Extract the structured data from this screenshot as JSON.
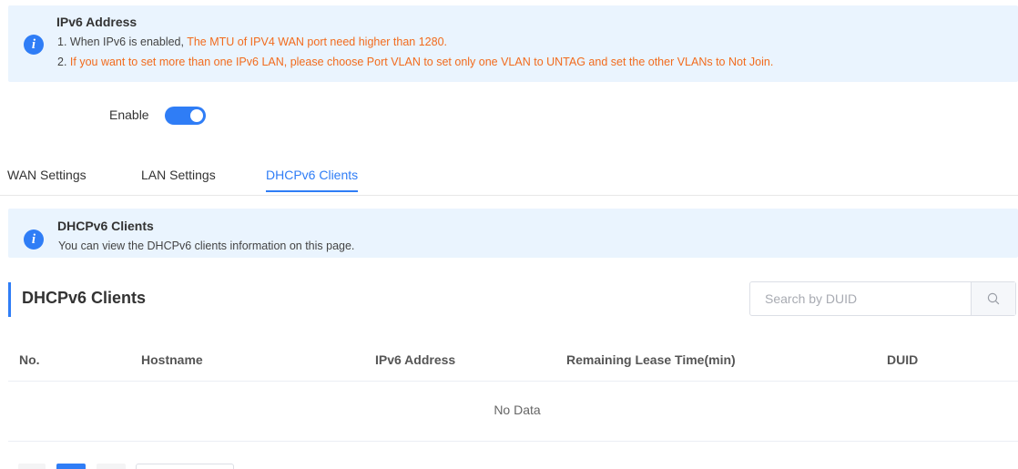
{
  "ipv6_banner": {
    "title": "IPv6 Address",
    "line1_prefix": "1. When IPv6 is enabled, ",
    "line1_highlight": "The MTU of IPV4 WAN port need higher than 1280.",
    "line2_prefix": "2. ",
    "line2_highlight": "If you want to set more than one IPv6 LAN, please choose Port VLAN to set only one VLAN to UNTAG and set the other VLANs to Not Join.",
    "icon": "info-icon"
  },
  "enable": {
    "label": "Enable",
    "on": true
  },
  "tabs": [
    {
      "label": "WAN Settings",
      "active": false
    },
    {
      "label": "LAN Settings",
      "active": false
    },
    {
      "label": "DHCPv6 Clients",
      "active": true
    }
  ],
  "dhcp_banner": {
    "title": "DHCPv6 Clients",
    "text": "You can view the DHCPv6 clients information on this page.",
    "icon": "info-icon"
  },
  "section": {
    "title": "DHCPv6 Clients"
  },
  "search": {
    "placeholder": "Search by DUID",
    "value": "",
    "icon": "search-icon"
  },
  "table": {
    "columns": [
      "No.",
      "Hostname",
      "IPv6 Address",
      "Remaining Lease Time(min)",
      "DUID"
    ],
    "rows": [],
    "empty_text": "No Data"
  },
  "colors": {
    "accent": "#2f7df6",
    "warning_text": "#f26b1d",
    "banner_bg": "#eaf4fe"
  }
}
